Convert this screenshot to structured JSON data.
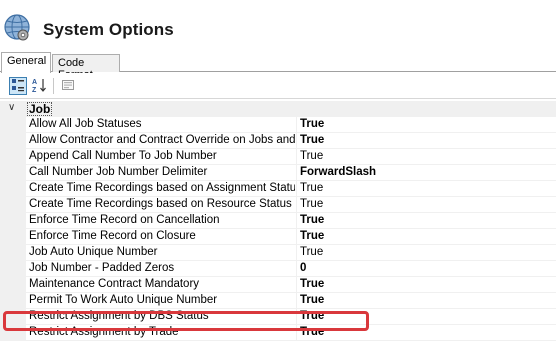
{
  "header": {
    "title": "System Options"
  },
  "tabs": [
    {
      "label": "General",
      "active": true
    },
    {
      "label": "Code Format",
      "active": false
    }
  ],
  "toolbar": {
    "buttons": [
      {
        "icon": "categorized-icon",
        "active": true
      },
      {
        "icon": "alphabetical-sort-icon",
        "active": false
      },
      {
        "icon": "property-pages-icon",
        "active": false
      }
    ]
  },
  "grid": {
    "category": {
      "label": "Job",
      "expanded": true
    },
    "rows": [
      {
        "name": "Allow All Job Statuses",
        "value": "True",
        "bold": true
      },
      {
        "name": "Allow Contractor and Contract Override on Jobs and Ord",
        "value": "True",
        "bold": true
      },
      {
        "name": "Append Call Number To Job Number",
        "value": "True",
        "bold": false
      },
      {
        "name": "Call Number Job Number Delimiter",
        "value": "ForwardSlash",
        "bold": true
      },
      {
        "name": "Create Time Recordings based on Assignment Status",
        "value": "True",
        "bold": false
      },
      {
        "name": "Create Time Recordings based on Resource Status",
        "value": "True",
        "bold": false
      },
      {
        "name": "Enforce Time Record on Cancellation",
        "value": "True",
        "bold": true,
        "highlighted": true
      },
      {
        "name": "Enforce Time Record on Closure",
        "value": "True",
        "bold": true
      },
      {
        "name": "Job Auto Unique Number",
        "value": "True",
        "bold": false
      },
      {
        "name": "Job Number - Padded Zeros",
        "value": "0",
        "bold": true
      },
      {
        "name": "Maintenance Contract Mandatory",
        "value": "True",
        "bold": true
      },
      {
        "name": "Permit To Work Auto Unique Number",
        "value": "True",
        "bold": true
      },
      {
        "name": "Restrict Assignment by DBS Status",
        "value": "True",
        "bold": true
      },
      {
        "name": "Restrict Assignment by Trade",
        "value": "True",
        "bold": true
      }
    ]
  },
  "colors": {
    "highlight": "#d9383c",
    "toolbar_active": "#cde6f7",
    "gutter": "#f0f0f0"
  }
}
